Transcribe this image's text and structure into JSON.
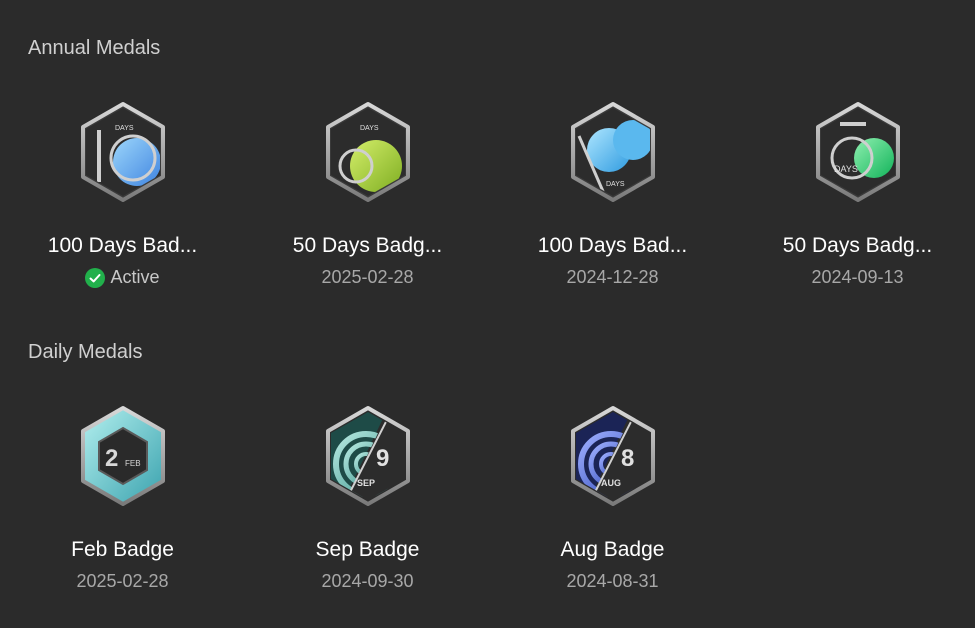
{
  "sections": {
    "annual": {
      "title": "Annual Medals",
      "items": [
        {
          "title": "100 Days Bad...",
          "subtitle": "Active",
          "badge_text": "DAYS",
          "numeral": "100",
          "colors": [
            "#4fa8f0",
            "#3b7fd6"
          ],
          "active": true
        },
        {
          "title": "50 Days Badg...",
          "subtitle": "2025-02-28",
          "badge_text": "DAYS",
          "numeral": "50",
          "colors": [
            "#b6d94a",
            "#86b62a"
          ],
          "active": false
        },
        {
          "title": "100 Days Bad...",
          "subtitle": "2024-12-28",
          "badge_text": "DAYS",
          "numeral": "100",
          "colors": [
            "#7fd0f5",
            "#3aa2e4"
          ],
          "active": false
        },
        {
          "title": "50 Days Badg...",
          "subtitle": "2024-09-13",
          "badge_text": "DAYS",
          "numeral": "50",
          "colors": [
            "#5fe08f",
            "#1fb865"
          ],
          "active": false
        }
      ]
    },
    "daily": {
      "title": "Daily Medals",
      "items": [
        {
          "title": "Feb Badge",
          "subtitle": "2025-02-28",
          "day": "2",
          "month": "FEB",
          "colors": [
            "#8fe0e0",
            "#3fa6b0"
          ]
        },
        {
          "title": "Sep Badge",
          "subtitle": "2024-09-30",
          "day": "9",
          "month": "SEP",
          "colors": [
            "#9cd8cf",
            "#3f9c93"
          ]
        },
        {
          "title": "Aug Badge",
          "subtitle": "2024-08-31",
          "day": "8",
          "month": "AUG",
          "colors": [
            "#7c8ff0",
            "#3049b8"
          ]
        }
      ]
    }
  },
  "active_color": "#21b04b",
  "icons": {
    "active": "check-circle-icon"
  }
}
